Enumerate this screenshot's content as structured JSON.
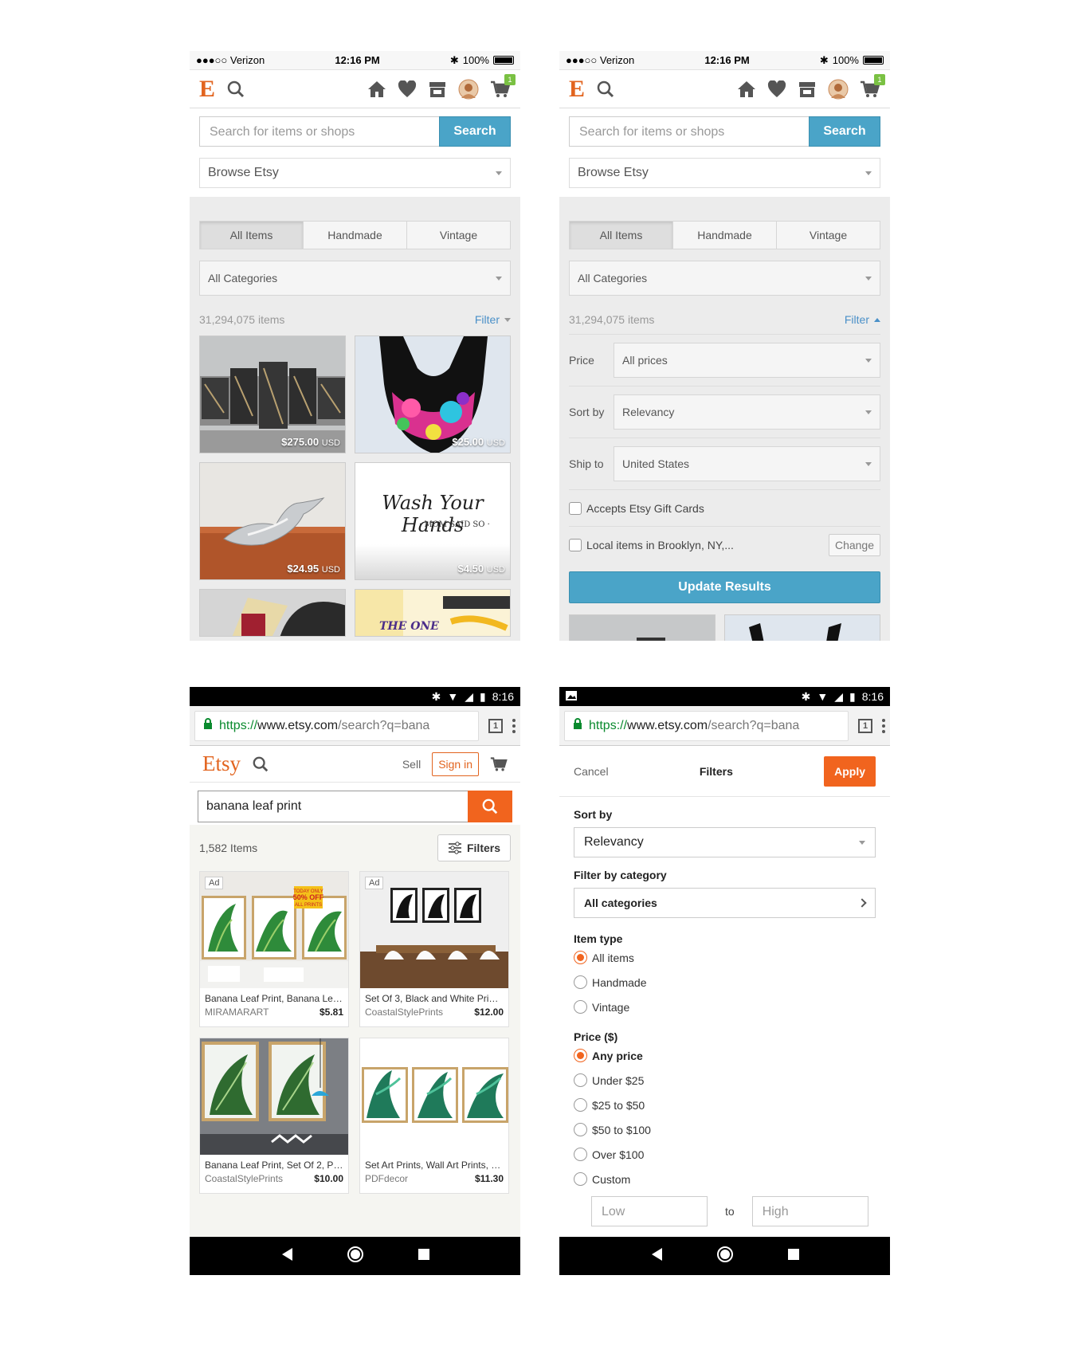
{
  "ios": {
    "carrier": "●●●○○ Verizon",
    "time": "12:16 PM",
    "battery": "100%",
    "logo": "E",
    "cart_count": "1",
    "search_placeholder": "Search for items or shops",
    "search_label": "Search",
    "browse_label": "Browse Etsy",
    "tabs": [
      "All Items",
      "Handmade",
      "Vintage"
    ],
    "category": "All Categories",
    "item_count": "31,294,075 items",
    "filter_label": "Filter",
    "listings": [
      {
        "price": "$275.00",
        "currency": "USD"
      },
      {
        "price": "$25.00",
        "currency": "USD"
      },
      {
        "price": "$24.95",
        "currency": "USD"
      },
      {
        "price": "$4.50",
        "currency": "USD",
        "image_text": "Wash Your Hands",
        "image_subtext": "· MOM SAID SO ·"
      }
    ],
    "extra_tile_text": "THE ONE",
    "filters": {
      "price_label": "Price",
      "price_value": "All prices",
      "sort_label": "Sort by",
      "sort_value": "Relevancy",
      "ship_label": "Ship to",
      "ship_value": "United States",
      "gift_cards": "Accepts Etsy Gift Cards",
      "local": "Local items in Brooklyn, NY,...",
      "change": "Change",
      "update": "Update Results"
    }
  },
  "android": {
    "time": "8:16",
    "url_scheme": "https://",
    "url_host": "www.etsy.com",
    "url_path": "/search?q=bana",
    "tab_count": "1",
    "etsy_word": "Etsy",
    "sell_label": "Sell",
    "signin_label": "Sign in",
    "query": "banana leaf print",
    "result_count": "1,582 Items",
    "filters_label": "Filters",
    "ad_label": "Ad",
    "products": [
      {
        "title": "Banana Leaf Print, Banana Leav..",
        "shop": "MIRAMARART",
        "price": "$5.81",
        "ad": true,
        "promo": "TODAY ONLY 50% OFF ALL PRINTS"
      },
      {
        "title": "Set Of 3, Black and White Prints..",
        "shop": "CoastalStylePrints",
        "price": "$12.00",
        "ad": true
      },
      {
        "title": "Banana Leaf Print, Set Of 2, Pho..",
        "shop": "CoastalStylePrints",
        "price": "$10.00",
        "ad": false
      },
      {
        "title": "Set Art Prints, Wall Art Prints, D...",
        "shop": "PDFdecor",
        "price": "$11.30",
        "ad": false
      }
    ],
    "filter_panel": {
      "cancel": "Cancel",
      "title": "Filters",
      "apply": "Apply",
      "sort_label": "Sort by",
      "sort_value": "Relevancy",
      "category_label": "Filter by category",
      "category_value": "All categories",
      "item_type_label": "Item type",
      "item_types": [
        "All items",
        "Handmade",
        "Vintage"
      ],
      "price_label": "Price ($)",
      "prices": [
        "Any price",
        "Under $25",
        "$25 to $50",
        "$50 to $100",
        "Over $100",
        "Custom"
      ],
      "low": "Low",
      "to": "to",
      "high": "High"
    }
  }
}
